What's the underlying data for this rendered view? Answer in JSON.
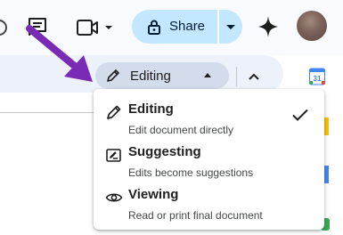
{
  "header": {
    "share_label": "Share",
    "icons": [
      "comment-icon",
      "video-call-icon",
      "lock-icon",
      "gemini-sparkle-icon"
    ],
    "share_color": "#c2e7ff"
  },
  "toolbar": {
    "mode_label": "Editing",
    "side_panel_icon": "google-calendar-icon"
  },
  "mode_menu": {
    "items": [
      {
        "title": "Editing",
        "description": "Edit document directly",
        "icon": "pencil-icon",
        "selected": true
      },
      {
        "title": "Suggesting",
        "description": "Edits become suggestions",
        "icon": "suggest-edit-icon",
        "selected": false
      },
      {
        "title": "Viewing",
        "description": "Read or print final document",
        "icon": "eye-icon",
        "selected": false
      }
    ]
  },
  "annotation": {
    "arrow_color": "#7a2bb5"
  }
}
